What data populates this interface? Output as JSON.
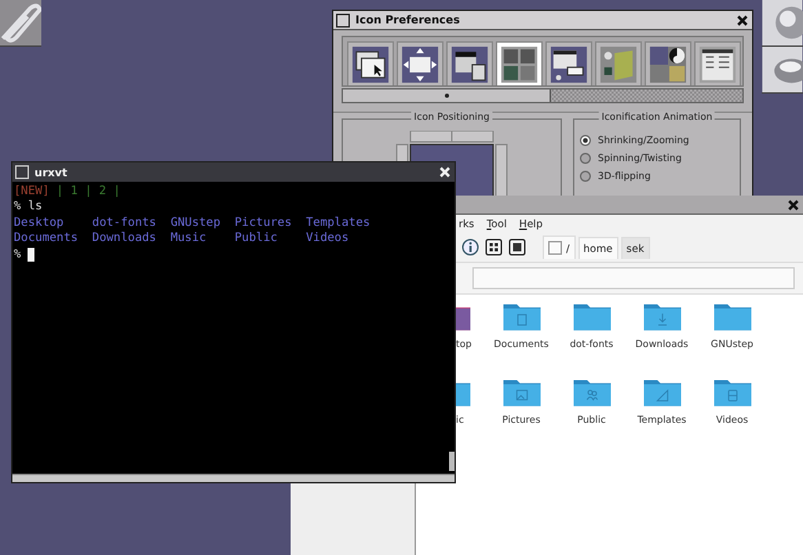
{
  "dock": {
    "left_tiles": [
      {
        "kind": "paperclip"
      }
    ],
    "right_tiles": [
      {
        "kind": "sphere"
      },
      {
        "kind": "disc"
      }
    ]
  },
  "icon_preferences": {
    "title": "Icon Preferences",
    "sections": [
      {
        "kind": "windows",
        "selected": false
      },
      {
        "kind": "move",
        "selected": false
      },
      {
        "kind": "menu",
        "selected": false
      },
      {
        "kind": "icons",
        "selected": true
      },
      {
        "kind": "popup",
        "selected": false
      },
      {
        "kind": "folder",
        "selected": false
      },
      {
        "kind": "workspace",
        "selected": false
      },
      {
        "kind": "config",
        "selected": false
      }
    ],
    "groups": [
      {
        "kind": "positioning",
        "title": "Icon Positioning"
      },
      {
        "kind": "radios",
        "title": "Iconification Animation",
        "options": [
          {
            "label": "Shrinking/Zooming",
            "selected": true
          },
          {
            "label": "Spinning/Twisting",
            "selected": false
          },
          {
            "label": "3D-flipping",
            "selected": false
          }
        ]
      }
    ]
  },
  "file_manager": {
    "menu": [
      {
        "label": "rks",
        "mnemonic": false
      },
      {
        "label": "Tool",
        "mnemonic": true
      },
      {
        "label": "Help",
        "mnemonic": true
      }
    ],
    "view_buttons": [
      {
        "kind": "info"
      },
      {
        "kind": "grid"
      },
      {
        "kind": "list"
      }
    ],
    "path": [
      {
        "label": "/",
        "selected": false
      },
      {
        "label": "home",
        "selected": false
      },
      {
        "label": "sek",
        "selected": true
      }
    ],
    "items": [
      {
        "label": "top",
        "kind": "desktop"
      },
      {
        "label": "Documents",
        "kind": "documents"
      },
      {
        "label": "dot-fonts",
        "kind": "fonts"
      },
      {
        "label": "Downloads",
        "kind": "downloads"
      },
      {
        "label": "GNUstep",
        "kind": "gnustep"
      },
      {
        "label": "ic",
        "kind": "music"
      },
      {
        "label": "Pictures",
        "kind": "pictures"
      },
      {
        "label": "Public",
        "kind": "public"
      },
      {
        "label": "Templates",
        "kind": "templates"
      },
      {
        "label": "Videos",
        "kind": "videos"
      }
    ]
  },
  "terminal": {
    "title": "urxvt",
    "new_tab": "[NEW]",
    "tabs": "| 1 | 2 |",
    "lines": [
      {
        "kind": "command",
        "text": "% ls"
      },
      {
        "kind": "listing",
        "items": [
          "Desktop",
          "dot-fonts",
          "GNUstep",
          "Pictures",
          "Templates"
        ]
      },
      {
        "kind": "listing",
        "items": [
          "Documents",
          "Downloads",
          "Music",
          "Public",
          "Videos"
        ]
      },
      {
        "kind": "cursor",
        "text": "%"
      }
    ]
  }
}
